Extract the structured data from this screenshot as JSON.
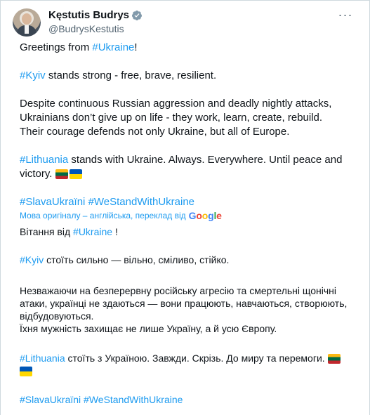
{
  "author": {
    "name": "Kęstutis Budrys",
    "handle": "@BudrysKestutis",
    "verified_icon": "verified-badge-icon",
    "more_label": "···"
  },
  "post_en": {
    "p1_text": "Greetings from ",
    "p1_tag": "#Ukraine",
    "p1_end": "!",
    "p2_tag": "#Kyiv",
    "p2_text": " stands strong - free, brave, resilient.",
    "p3_line1": "Despite continuous Russian aggression and deadly nightly attacks,",
    "p3_line2": "Ukrainians don’t give up on life - they work, learn, create, rebuild.",
    "p3_line3": "Their courage defends not only Ukraine, but all of Europe.",
    "p4_tag": "#Lithuania",
    "p4_text_line1": " stands with Ukraine. Always. Everywhere. Until peace and",
    "p4_text_line2": "victory. ",
    "p5_tag1": "#SlavaUkraïni",
    "p5_tag2": "#WeStandWithUkraine"
  },
  "translation": {
    "notice": "Мова оригіналу – англійська, переклад від",
    "google_letters": [
      "G",
      "o",
      "o",
      "g",
      "l",
      "e"
    ],
    "google_colors": [
      "#4285f4",
      "#ea4335",
      "#fbbc05",
      "#4285f4",
      "#34a853",
      "#ea4335"
    ]
  },
  "post_uk": {
    "p1_text": "Вітання від ",
    "p1_tag": "#Ukraine",
    "p1_end": " !",
    "p2_tag": "#Kyiv",
    "p2_text": " стоїть сильно — вільно, сміливо, стійко.",
    "p3_line1": "Незважаючи на безперервну російську агресію та смертельні щонічні",
    "p3_line2": "атаки, українці не здаються — вони працюють, навчаються, створюють,",
    "p3_line3": "відбудовуються.",
    "p3_line4": "Їхня мужність захищає не лише Україну, а й усю Європу.",
    "p4_tag": "#Lithuania",
    "p4_text": " стоїть з Україною. Завжди. Скрізь. До миру та перемоги. ",
    "p5_tag1": "#SlavaUkraïni",
    "p5_tag2": "#WeStandWithUkraine"
  },
  "colors": {
    "link": "#1d9bf0",
    "muted": "#536471",
    "text": "#0f1419"
  }
}
